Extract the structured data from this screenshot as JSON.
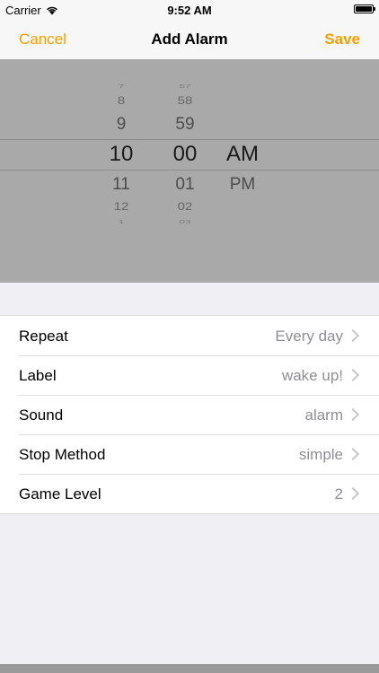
{
  "status_bar": {
    "carrier": "Carrier",
    "time": "9:52 AM",
    "icons": [
      "wifi-icon",
      "battery-icon"
    ]
  },
  "nav": {
    "cancel_label": "Cancel",
    "title": "Add Alarm",
    "save_label": "Save"
  },
  "picker": {
    "hour": {
      "m3": "7",
      "m2": "8",
      "m1": "9",
      "selected": "10",
      "p1": "11",
      "p2": "12",
      "p3": "1"
    },
    "minute": {
      "m3": "57",
      "m2": "58",
      "m1": "59",
      "selected": "00",
      "p1": "01",
      "p2": "02",
      "p3": "03"
    },
    "period": {
      "selected": "AM",
      "p1": "PM"
    }
  },
  "settings": {
    "items": [
      {
        "label": "Repeat",
        "value": "Every day"
      },
      {
        "label": "Label",
        "value": "wake up!"
      },
      {
        "label": "Sound",
        "value": "alarm"
      },
      {
        "label": "Stop Method",
        "value": "simple"
      },
      {
        "label": "Game Level",
        "value": "2"
      }
    ]
  },
  "colors": {
    "accent": "#f5a000",
    "picker_background": "#a9a9a9",
    "secondary_text": "#8e8e93"
  }
}
